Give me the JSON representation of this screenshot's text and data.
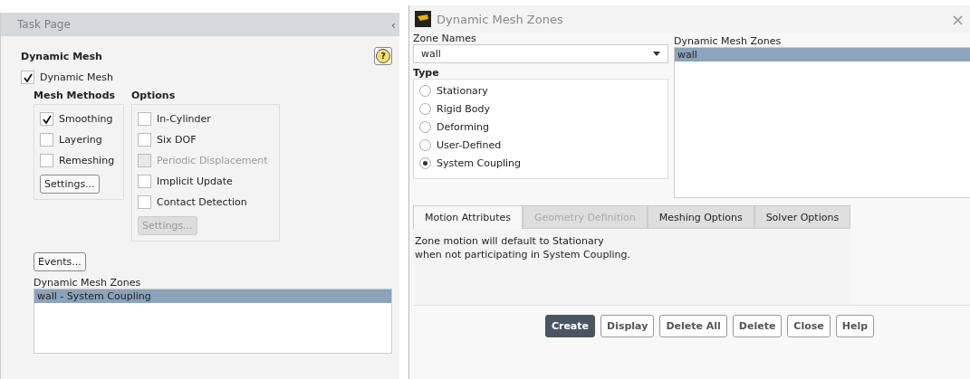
{
  "task_page": {
    "title": "Task Page",
    "collapse_glyph": "‹",
    "heading": "Dynamic Mesh",
    "help_glyph": "?",
    "dynamic_mesh": {
      "label": "Dynamic Mesh",
      "checked": true
    },
    "mesh_methods": {
      "title": "Mesh Methods",
      "items": [
        {
          "label": "Smoothing",
          "checked": true,
          "disabled": false
        },
        {
          "label": "Layering",
          "checked": false,
          "disabled": false
        },
        {
          "label": "Remeshing",
          "checked": false,
          "disabled": false
        }
      ],
      "button": {
        "label": "Settings...",
        "disabled": false
      }
    },
    "options": {
      "title": "Options",
      "items": [
        {
          "label": "In-Cylinder",
          "checked": false,
          "disabled": false
        },
        {
          "label": "Six DOF",
          "checked": false,
          "disabled": false
        },
        {
          "label": "Periodic Displacement",
          "checked": false,
          "disabled": true
        },
        {
          "label": "Implicit Update",
          "checked": false,
          "disabled": false
        },
        {
          "label": "Contact Detection",
          "checked": false,
          "disabled": false
        }
      ],
      "button": {
        "label": "Settings...",
        "disabled": true
      }
    },
    "events_button": "Events...",
    "zones": {
      "title": "Dynamic Mesh Zones",
      "items": [
        {
          "label": "wall - System Coupling",
          "selected": true
        }
      ]
    }
  },
  "dialog": {
    "title": "Dynamic Mesh Zones",
    "close_glyph": "×",
    "zone_names": {
      "label": "Zone Names",
      "value": "wall"
    },
    "type": {
      "title": "Type",
      "options": [
        {
          "label": "Stationary",
          "selected": false
        },
        {
          "label": "Rigid Body",
          "selected": false
        },
        {
          "label": "Deforming",
          "selected": false
        },
        {
          "label": "User-Defined",
          "selected": false
        },
        {
          "label": "System Coupling",
          "selected": true
        }
      ]
    },
    "zones": {
      "title": "Dynamic Mesh Zones",
      "items": [
        {
          "label": "wall",
          "selected": true
        }
      ]
    },
    "tabs": [
      {
        "label": "Motion Attributes",
        "selected": true,
        "disabled": false
      },
      {
        "label": "Geometry Definition",
        "selected": false,
        "disabled": true
      },
      {
        "label": "Meshing Options",
        "selected": false,
        "disabled": false
      },
      {
        "label": "Solver Options",
        "selected": false,
        "disabled": false
      }
    ],
    "message": [
      "Zone motion will default to Stationary",
      "when not participating in System Coupling."
    ],
    "buttons": [
      {
        "label": "Create",
        "kind": "primary"
      },
      {
        "label": "Display",
        "kind": "normal"
      },
      {
        "label": "Delete All",
        "kind": "normal"
      },
      {
        "label": "Delete",
        "kind": "normal"
      },
      {
        "label": "Close",
        "kind": "normal"
      },
      {
        "label": "Help",
        "kind": "normal"
      }
    ]
  }
}
